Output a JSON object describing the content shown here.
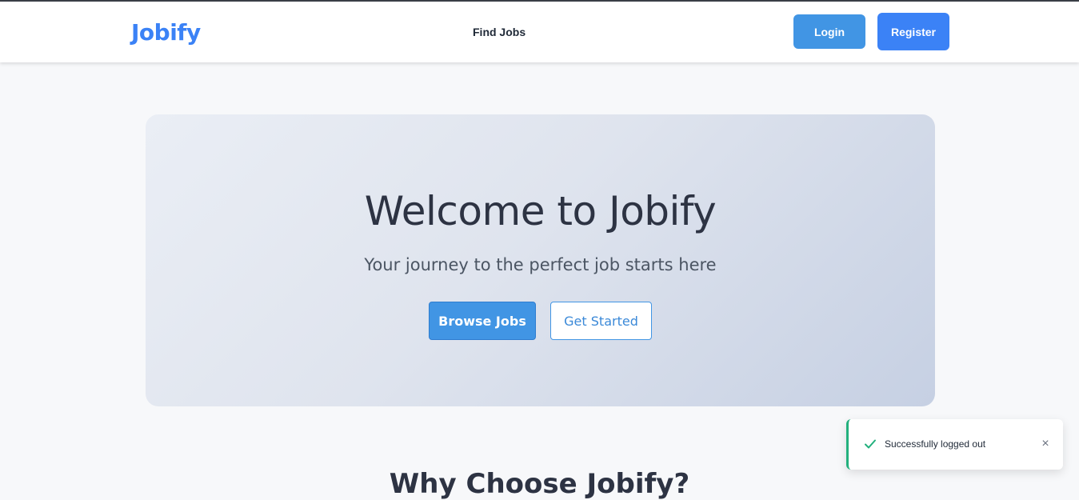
{
  "header": {
    "logo": "Jobify",
    "nav": {
      "find_jobs": "Find Jobs"
    },
    "login_label": "Login",
    "register_label": "Register"
  },
  "hero": {
    "title": "Welcome to Jobify",
    "subtitle": "Your journey to the perfect job starts here",
    "browse_label": "Browse Jobs",
    "started_label": "Get Started"
  },
  "section": {
    "title": "Why Choose Jobify?"
  },
  "toast": {
    "message": "Successfully logged out",
    "close": "×",
    "icon": "check-icon"
  },
  "colors": {
    "brand": "#3b82f6",
    "primary_button": "#4195e4",
    "success": "#22b07d"
  }
}
